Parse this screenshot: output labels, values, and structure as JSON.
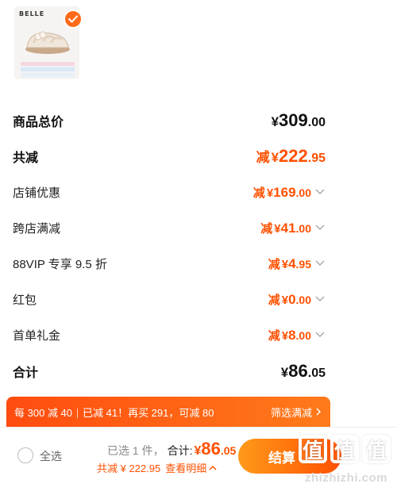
{
  "product": {
    "brand": "BELLE",
    "icons": {
      "check": "checkmark-icon"
    }
  },
  "rows": [
    {
      "label": "商品总价",
      "prefix": "",
      "currency": "¥",
      "int": "309",
      "dec": ".00",
      "style": "black-bold",
      "chevron": false
    },
    {
      "label": "共减",
      "prefix": "减",
      "currency": "¥",
      "int": "222",
      "dec": ".95",
      "style": "orange-bold",
      "chevron": false
    },
    {
      "label": "店铺优惠",
      "prefix": "减",
      "currency": "¥",
      "int": "169",
      "dec": ".00",
      "style": "orange",
      "chevron": true
    },
    {
      "label": "跨店满减",
      "prefix": "减",
      "currency": "¥",
      "int": "41",
      "dec": ".00",
      "style": "orange",
      "chevron": true
    },
    {
      "label": "88VIP 专享 9.5 折",
      "prefix": "减",
      "currency": "¥",
      "int": "4",
      "dec": ".95",
      "style": "orange",
      "chevron": true
    },
    {
      "label": "红包",
      "prefix": "减",
      "currency": "¥",
      "int": "0",
      "dec": ".00",
      "style": "orange",
      "chevron": true
    },
    {
      "label": "首单礼金",
      "prefix": "减",
      "currency": "¥",
      "int": "8",
      "dec": ".00",
      "style": "orange",
      "chevron": true
    },
    {
      "label": "合计",
      "prefix": "",
      "currency": "¥",
      "int": "86",
      "dec": ".05",
      "style": "black-bold",
      "chevron": false
    }
  ],
  "promo": {
    "part1": "每 300 减 40",
    "part2": "已减 41！再买 291，可减 80",
    "link": "筛选满减",
    "link_icon": "chevron-right-icon"
  },
  "footer": {
    "select_all": "全选",
    "selected": "已选 1 件，",
    "total_label": "合计:",
    "currency": "¥",
    "total_int": "86",
    "total_dec": ".05",
    "discount": "共减 ¥ 222.95",
    "detail": "查看明细",
    "settle": "结算"
  },
  "watermark": {
    "chars": [
      "值",
      "值",
      "值"
    ],
    "site": "zhizhizhi.com"
  },
  "colors": {
    "accent": "#ff5000",
    "promo_start": "#ff4c10",
    "promo_end": "#ff7a1a"
  }
}
